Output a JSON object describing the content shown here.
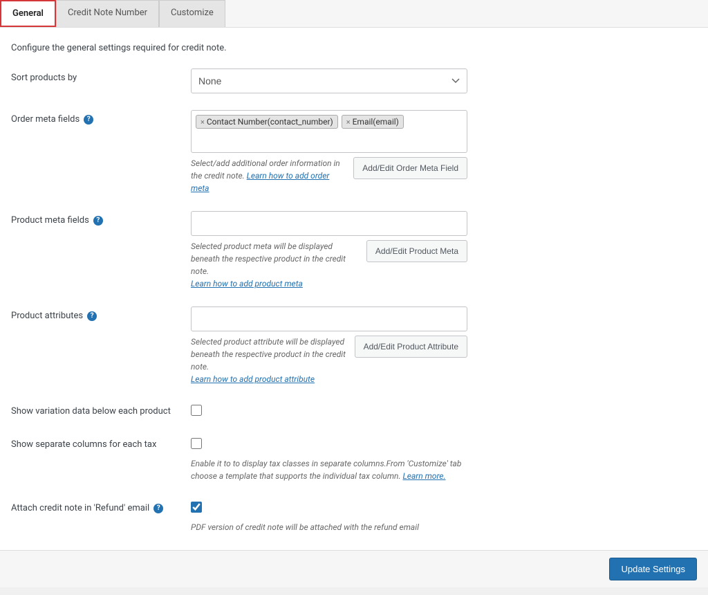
{
  "tabs": {
    "general": "General",
    "creditNoteNumber": "Credit Note Number",
    "customize": "Customize"
  },
  "introText": "Configure the general settings required for credit note.",
  "sortProducts": {
    "label": "Sort products by",
    "value": "None"
  },
  "orderMeta": {
    "label": "Order meta fields",
    "tags": [
      "Contact Number(contact_number)",
      "Email(email)"
    ],
    "desc": "Select/add additional order information in the credit note. ",
    "link": "Learn how to add order meta",
    "button": "Add/Edit Order Meta Field"
  },
  "productMeta": {
    "label": "Product meta fields",
    "desc": "Selected product meta will be displayed beneath the respective product in the credit note.",
    "link": "Learn how to add product meta",
    "button": "Add/Edit Product Meta"
  },
  "productAttr": {
    "label": "Product attributes",
    "desc": "Selected product attribute will be displayed beneath the respective product in the credit note.",
    "link": "Learn how to add product attribute",
    "button": "Add/Edit Product Attribute"
  },
  "variation": {
    "label": "Show variation data below each product"
  },
  "taxColumns": {
    "label": "Show separate columns for each tax",
    "desc": "Enable it to to display tax classes in separate columns.From 'Customize' tab choose a template that supports the individual tax column. ",
    "link": "Learn more."
  },
  "attachRefund": {
    "label": "Attach credit note in 'Refund' email",
    "desc": "PDF version of credit note will be attached with the refund email"
  },
  "footer": {
    "button": "Update Settings"
  }
}
